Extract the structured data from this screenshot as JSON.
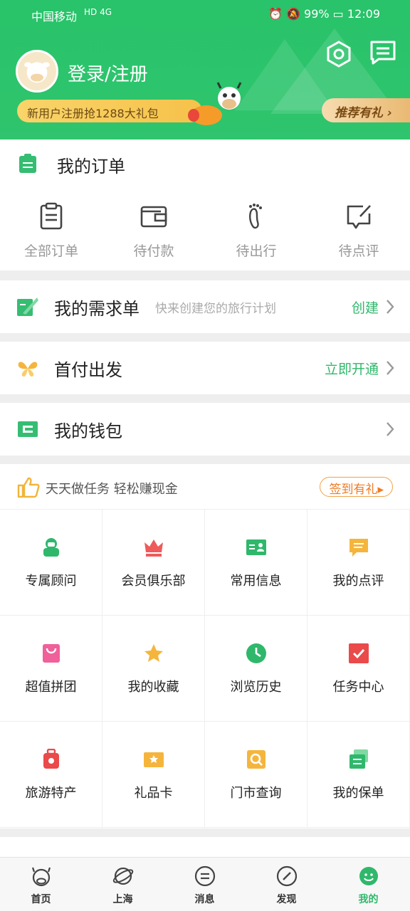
{
  "status_bar": {
    "carrier": "中国移动",
    "network": "HD 4G",
    "battery": "99%",
    "time": "12:09"
  },
  "header": {
    "login_label": "登录/注册",
    "promo_text": "新用户注册抢1288大礼包",
    "recommend_label": "推荐有礼"
  },
  "orders": {
    "title": "我的订单",
    "items": [
      {
        "label": "全部订单",
        "icon": "clipboard-icon"
      },
      {
        "label": "待付款",
        "icon": "wallet-icon"
      },
      {
        "label": "待出行",
        "icon": "footprints-icon"
      },
      {
        "label": "待点评",
        "icon": "edit-comment-icon"
      }
    ]
  },
  "demand": {
    "title": "我的需求单",
    "subtitle": "快来创建您的旅行计划",
    "action": "创建"
  },
  "first_pay": {
    "title": "首付出发",
    "action": "立即开通"
  },
  "wallet": {
    "title": "我的钱包"
  },
  "tasks": {
    "title": "天天做任务  轻松赚现金",
    "checkin": "签到有礼",
    "grid": [
      {
        "label": "专属顾问",
        "icon": "advisor-icon"
      },
      {
        "label": "会员俱乐部",
        "icon": "crown-icon"
      },
      {
        "label": "常用信息",
        "icon": "id-card-icon"
      },
      {
        "label": "我的点评",
        "icon": "comment-icon"
      },
      {
        "label": "超值拼团",
        "icon": "shopping-bag-icon"
      },
      {
        "label": "我的收藏",
        "icon": "star-icon"
      },
      {
        "label": "浏览历史",
        "icon": "clock-icon"
      },
      {
        "label": "任务中心",
        "icon": "task-check-icon"
      },
      {
        "label": "旅游特产",
        "icon": "luggage-icon"
      },
      {
        "label": "礼品卡",
        "icon": "gift-card-icon"
      },
      {
        "label": "门市查询",
        "icon": "store-search-icon"
      },
      {
        "label": "我的保单",
        "icon": "policy-icon"
      }
    ]
  },
  "nav": [
    {
      "label": "首页",
      "icon": "home-icon"
    },
    {
      "label": "上海",
      "icon": "planet-icon"
    },
    {
      "label": "消息",
      "icon": "message-icon"
    },
    {
      "label": "发现",
      "icon": "compass-icon"
    },
    {
      "label": "我的",
      "icon": "profile-icon",
      "active": true
    }
  ],
  "colors": {
    "brand_green": "#2fc46d",
    "accent_orange": "#f07a22"
  }
}
